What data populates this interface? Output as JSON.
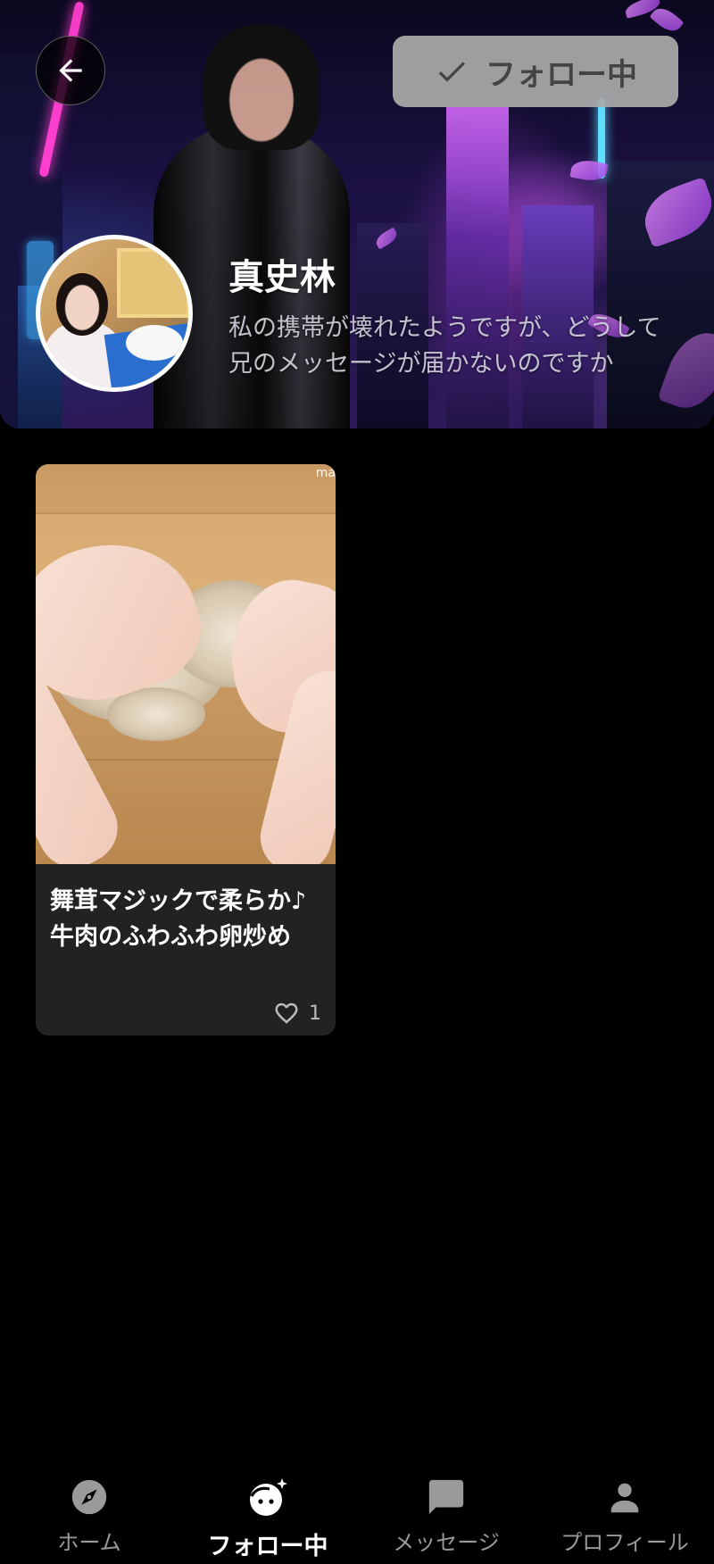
{
  "header": {
    "follow_label": "フォロー中",
    "follow_state": true,
    "user_name": "真史林",
    "user_bio": "私の携帯が壊れたようですが、どうして兄のメッセージが届かないのですか"
  },
  "posts": [
    {
      "title": "舞茸マジックで柔らか♪牛肉のふわふわ卵炒め",
      "watermark": "ma",
      "likes": "1"
    }
  ],
  "bottom_nav": {
    "items": [
      {
        "label": "ホーム",
        "icon": "compass-icon",
        "active": false
      },
      {
        "label": "フォロー中",
        "icon": "face-sparkle-icon",
        "active": true
      },
      {
        "label": "メッセージ",
        "icon": "chat-bubble-icon",
        "active": false
      },
      {
        "label": "プロフィール",
        "icon": "person-icon",
        "active": false
      }
    ]
  },
  "colors": {
    "background": "#000000",
    "follow_button": "#aaaaaa",
    "card_background": "#222222",
    "nav_inactive": "#9a9a9a",
    "nav_active": "#ffffff"
  }
}
